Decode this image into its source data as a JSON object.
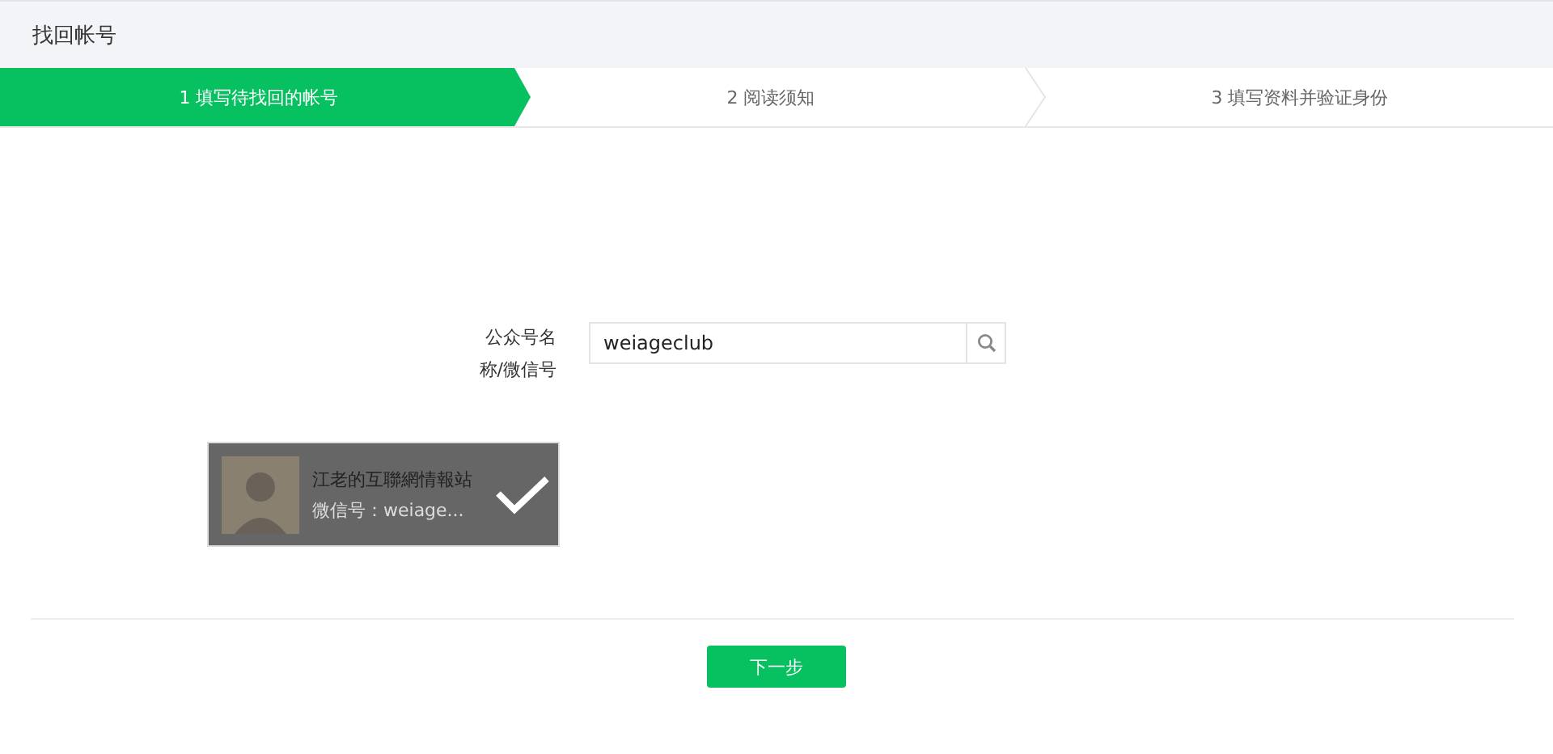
{
  "header": {
    "title": "找回帐号"
  },
  "steps": [
    {
      "label": "1 填写待找回的帐号",
      "selected": true
    },
    {
      "label": "2 阅读须知",
      "selected": false
    },
    {
      "label": "3 填写资料并验证身份",
      "selected": false
    }
  ],
  "form": {
    "label": "公众号名称/微信号",
    "value": "weiageclub"
  },
  "results": [
    {
      "name": "江老的互聯網情報站",
      "id": "微信号：weiage...",
      "selected": true
    }
  ],
  "next_button": "下一步"
}
